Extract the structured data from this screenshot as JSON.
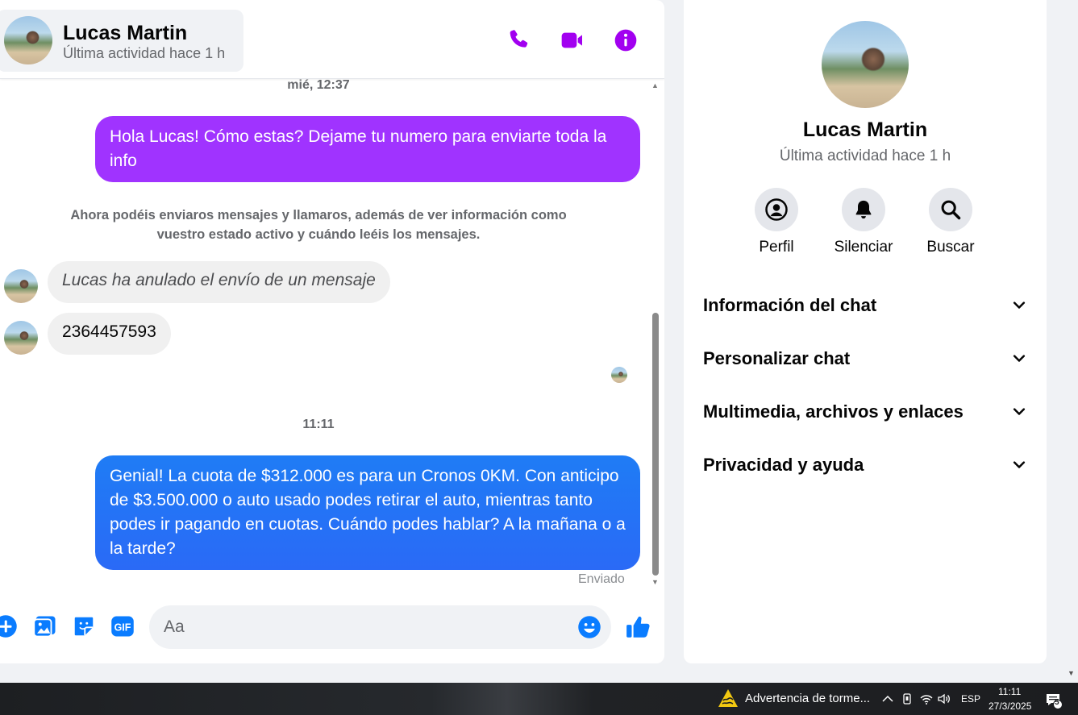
{
  "header": {
    "name": "Lucas Martin",
    "status": "Última actividad hace 1 h",
    "icons": [
      "phone-icon",
      "video-call-icon",
      "info-icon"
    ]
  },
  "conversation": {
    "timestamp_1": "mié, 12:37",
    "outgoing_1": "Hola Lucas! Cómo estas? Dejame tu numero para enviarte toda la info",
    "system_message": "Ahora podéis enviaros mensajes y llamaros, además de ver información como vuestro estado activo y cuándo leéis los mensajes.",
    "incoming_1": "Lucas ha anulado el envío de un mensaje",
    "incoming_2": "2364457593",
    "timestamp_2": "11:11",
    "outgoing_2": "Genial! La cuota de $312.000 es para un Cronos 0KM. Con anticipo de $3.500.000 o auto usado podes retirar el auto, mientras tanto podes ir pagando en cuotas. Cuándo podes hablar? A la mañana o a la tarde?",
    "sent_status": "Enviado"
  },
  "composer": {
    "placeholder": "Aa",
    "icons": [
      "plus-icon",
      "image-icon",
      "sticker-icon",
      "gif-icon",
      "emoji-icon",
      "like-icon"
    ],
    "gif_label": "GIF"
  },
  "info_panel": {
    "name": "Lucas Martin",
    "status": "Última actividad hace 1 h",
    "actions": [
      {
        "label": "Perfil",
        "icon": "profile-icon"
      },
      {
        "label": "Silenciar",
        "icon": "bell-icon"
      },
      {
        "label": "Buscar",
        "icon": "search-icon"
      }
    ],
    "sections": [
      "Información del chat",
      "Personalizar chat",
      "Multimedia, archivos y enlaces",
      "Privacidad y ayuda"
    ]
  },
  "taskbar": {
    "weather_alert": "Advertencia de torme...",
    "language": "ESP",
    "time": "11:11",
    "date": "27/3/2025",
    "notification_count": "5"
  },
  "colors": {
    "accent_purple": "#a033ff",
    "accent_blue": "#1f7cf5",
    "icon_purple": "#a200f0",
    "icon_blue": "#0a7cff"
  }
}
